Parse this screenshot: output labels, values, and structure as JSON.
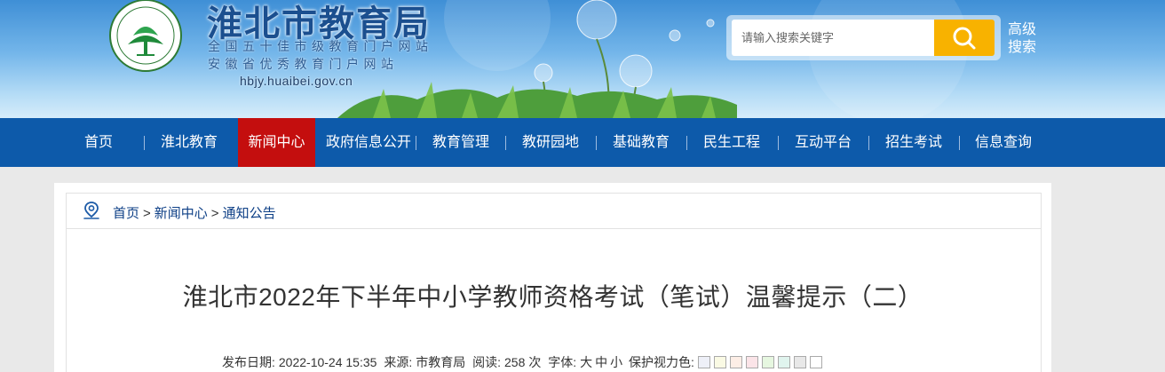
{
  "header": {
    "site_title": "淮北市教育局",
    "subtitle_1": "全国五十佳市级教育门户网站",
    "subtitle_2": "安徽省优秀教育门户网站",
    "url": "hbjy.huaibei.gov.cn",
    "search_placeholder": "请输入搜索关键字",
    "advanced_search": "高级搜索"
  },
  "nav": {
    "items": [
      {
        "label": "首页"
      },
      {
        "label": "淮北教育"
      },
      {
        "label": "新闻中心",
        "active": true
      },
      {
        "label": "政府信息公开"
      },
      {
        "label": "教育管理"
      },
      {
        "label": "教研园地"
      },
      {
        "label": "基础教育"
      },
      {
        "label": "民生工程"
      },
      {
        "label": "互动平台"
      },
      {
        "label": "招生考试"
      },
      {
        "label": "信息查询"
      }
    ]
  },
  "breadcrumb": {
    "items": [
      "首页",
      "新闻中心",
      "通知公告"
    ],
    "separator": ">"
  },
  "article": {
    "title": "淮北市2022年下半年中小学教师资格考试（笔试）温馨提示（二）",
    "publish_label": "发布日期:",
    "publish_date": "2022-10-24 15:35",
    "source_label": "来源:",
    "source": "市教育局",
    "views_label": "阅读:",
    "views": "258",
    "views_unit": "次",
    "font_label": "字体:",
    "font_large": "大",
    "font_medium": "中",
    "font_small": "小",
    "eye_care_label": "保护视力色:"
  },
  "colors": {
    "nav_bg": "#0d5aaa",
    "nav_active": "#c40e0e",
    "search_button": "#f8b200",
    "eye_care_swatches": [
      "#eef0f8",
      "#fafae4",
      "#fdeee6",
      "#fbe4e8",
      "#e6f7e0",
      "#e0f4ee",
      "#e8e8e8",
      "#ffffff"
    ]
  }
}
